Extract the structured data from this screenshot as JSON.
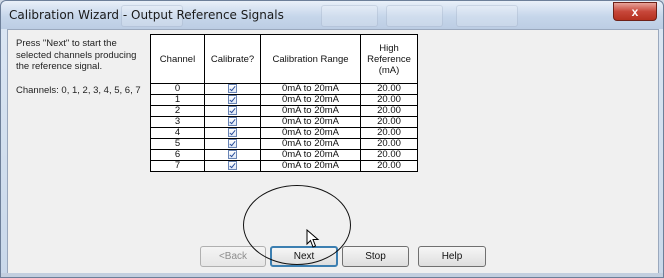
{
  "window": {
    "title": "Calibration Wizard - Output Reference Signals",
    "close_label": "x"
  },
  "instructions": {
    "line1": "Press \"Next\" to start the selected channels producing the reference signal.",
    "line2": "Channels: 0, 1, 2, 3, 4, 5, 6, 7"
  },
  "table": {
    "headers": {
      "channel": "Channel",
      "calibrate": "Calibrate?",
      "range": "Calibration Range",
      "ref": "High Reference (mA)"
    },
    "rows": [
      {
        "channel": "0",
        "calibrate": true,
        "range": "0mA to 20mA",
        "ref": "20.00"
      },
      {
        "channel": "1",
        "calibrate": true,
        "range": "0mA to 20mA",
        "ref": "20.00"
      },
      {
        "channel": "2",
        "calibrate": true,
        "range": "0mA to 20mA",
        "ref": "20.00"
      },
      {
        "channel": "3",
        "calibrate": true,
        "range": "0mA to 20mA",
        "ref": "20.00"
      },
      {
        "channel": "4",
        "calibrate": true,
        "range": "0mA to 20mA",
        "ref": "20.00"
      },
      {
        "channel": "5",
        "calibrate": true,
        "range": "0mA to 20mA",
        "ref": "20.00"
      },
      {
        "channel": "6",
        "calibrate": true,
        "range": "0mA to 20mA",
        "ref": "20.00"
      },
      {
        "channel": "7",
        "calibrate": true,
        "range": "0mA to 20mA",
        "ref": "20.00"
      }
    ]
  },
  "buttons": {
    "back": "<Back",
    "next": "Next",
    "stop": "Stop",
    "help": "Help"
  },
  "annotation": {
    "oval_color": "#111111"
  }
}
